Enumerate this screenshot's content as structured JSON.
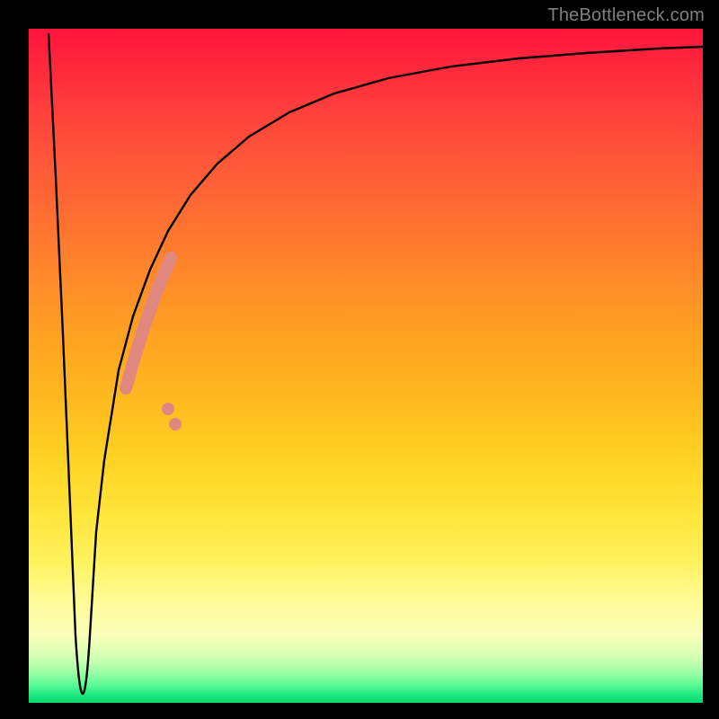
{
  "attribution": "TheBottleneck.com",
  "chart_data": {
    "type": "line",
    "title": "",
    "xlabel": "",
    "ylabel": "",
    "xlim": [
      0,
      100
    ],
    "ylim": [
      0,
      100
    ],
    "grid": false,
    "legend": false,
    "series": [
      {
        "name": "bottleneck-curve",
        "x": [
          3,
          4,
          5,
          6,
          7,
          7.5,
          8,
          9,
          10,
          12,
          14,
          16,
          18,
          20,
          24,
          28,
          32,
          38,
          45,
          55,
          65,
          75,
          85,
          95,
          100
        ],
        "y": [
          99,
          78,
          55,
          30,
          10,
          2,
          10,
          25,
          36,
          50,
          59,
          66,
          71,
          75,
          80,
          84,
          87,
          90,
          92,
          94,
          95.2,
          96,
          96.6,
          97,
          97.3
        ]
      }
    ],
    "annotations": [
      {
        "name": "highlight-segment",
        "type": "thick-line",
        "color": "#e58a80",
        "x": [
          14,
          15,
          16,
          17,
          18,
          19,
          20,
          21,
          22
        ],
        "y": [
          46,
          50,
          53,
          56,
          58.5,
          60.8,
          63,
          41,
          43
        ]
      }
    ]
  }
}
